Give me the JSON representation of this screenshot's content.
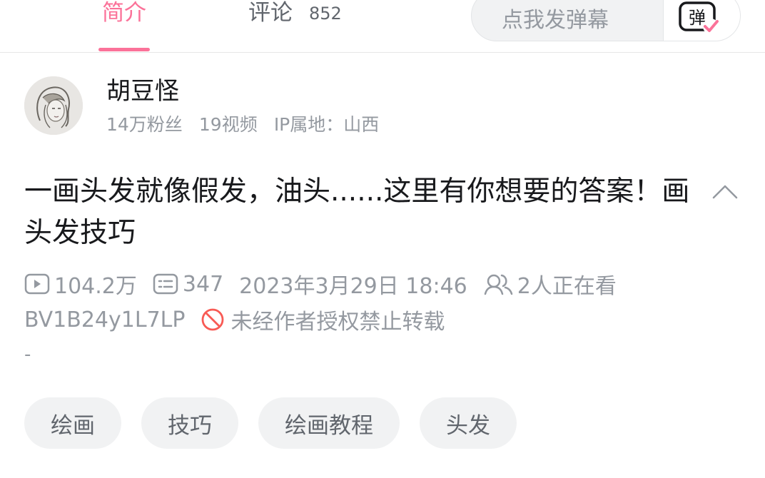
{
  "tabs": {
    "intro": "简介",
    "comments": "评论",
    "comment_count": "852"
  },
  "danmaku": {
    "placeholder": "点我发弹幕",
    "button_label": "弹"
  },
  "uploader": {
    "name": "胡豆怪",
    "followers": "14万粉丝",
    "videos": "19视频",
    "ip": "IP属地：山西"
  },
  "video": {
    "title": "一画头发就像假发，油头......这里有你想要的答案！画头发技巧",
    "views": "104.2万",
    "danmaku_count": "347",
    "date": "2023年3月29日 18:46",
    "watching": "2人正在看",
    "bvid": "BV1B24y1L7LP",
    "copyright": "未经作者授权禁止转载",
    "description": "-"
  },
  "tags": [
    "绘画",
    "技巧",
    "绘画教程",
    "头发"
  ],
  "colors": {
    "accent": "#fb7299",
    "text_primary": "#18191c",
    "text_secondary": "#9499a0",
    "tag_bg": "#f1f2f3",
    "warning": "#f85a54"
  },
  "icons": {
    "views": "play-count-icon",
    "danmaku": "danmaku-count-icon",
    "watching": "watching-people-icon",
    "copyright": "prohibited-icon",
    "collapse": "chevron-up-icon"
  }
}
